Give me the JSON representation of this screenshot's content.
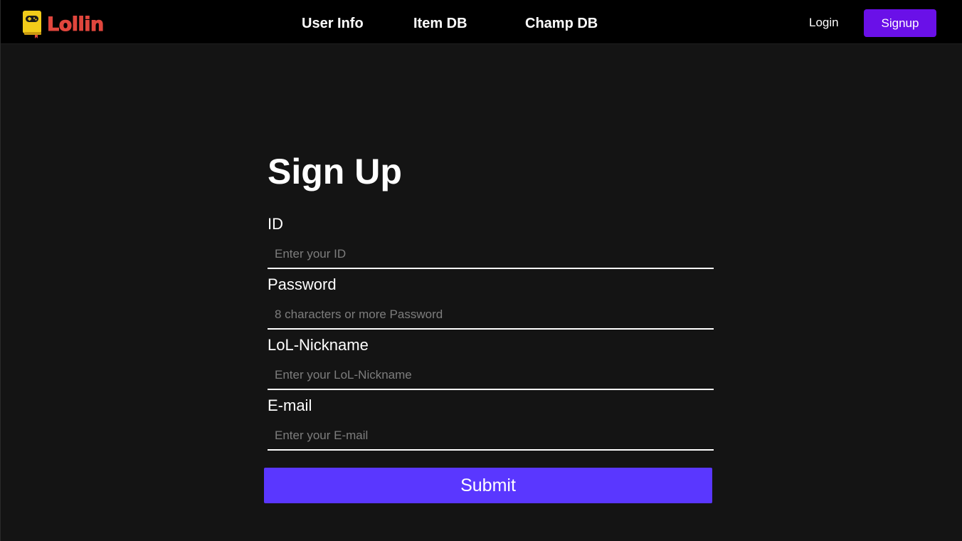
{
  "header": {
    "logo_text": "Lollin",
    "nav": {
      "user_info": "User Info",
      "item_db": "Item DB",
      "champ_db": "Champ DB"
    },
    "login_label": "Login",
    "signup_label": "Signup"
  },
  "form": {
    "title": "Sign Up",
    "fields": [
      {
        "label": "ID",
        "placeholder": "Enter your ID",
        "value": ""
      },
      {
        "label": "Password",
        "placeholder": "8 characters or more Password",
        "value": ""
      },
      {
        "label": "LoL-Nickname",
        "placeholder": "Enter your LoL-Nickname",
        "value": ""
      },
      {
        "label": "E-mail",
        "placeholder": "Enter your E-mail",
        "value": ""
      }
    ],
    "submit_label": "Submit"
  },
  "icons": {
    "logo": "gamepad-book-icon"
  },
  "colors": {
    "background": "#141414",
    "header_background": "#000000",
    "signup_button": "#6a10e8",
    "submit_button": "#5a37ff",
    "logo_text": "#e0463d",
    "logo_icon": "#f2cc1a"
  }
}
